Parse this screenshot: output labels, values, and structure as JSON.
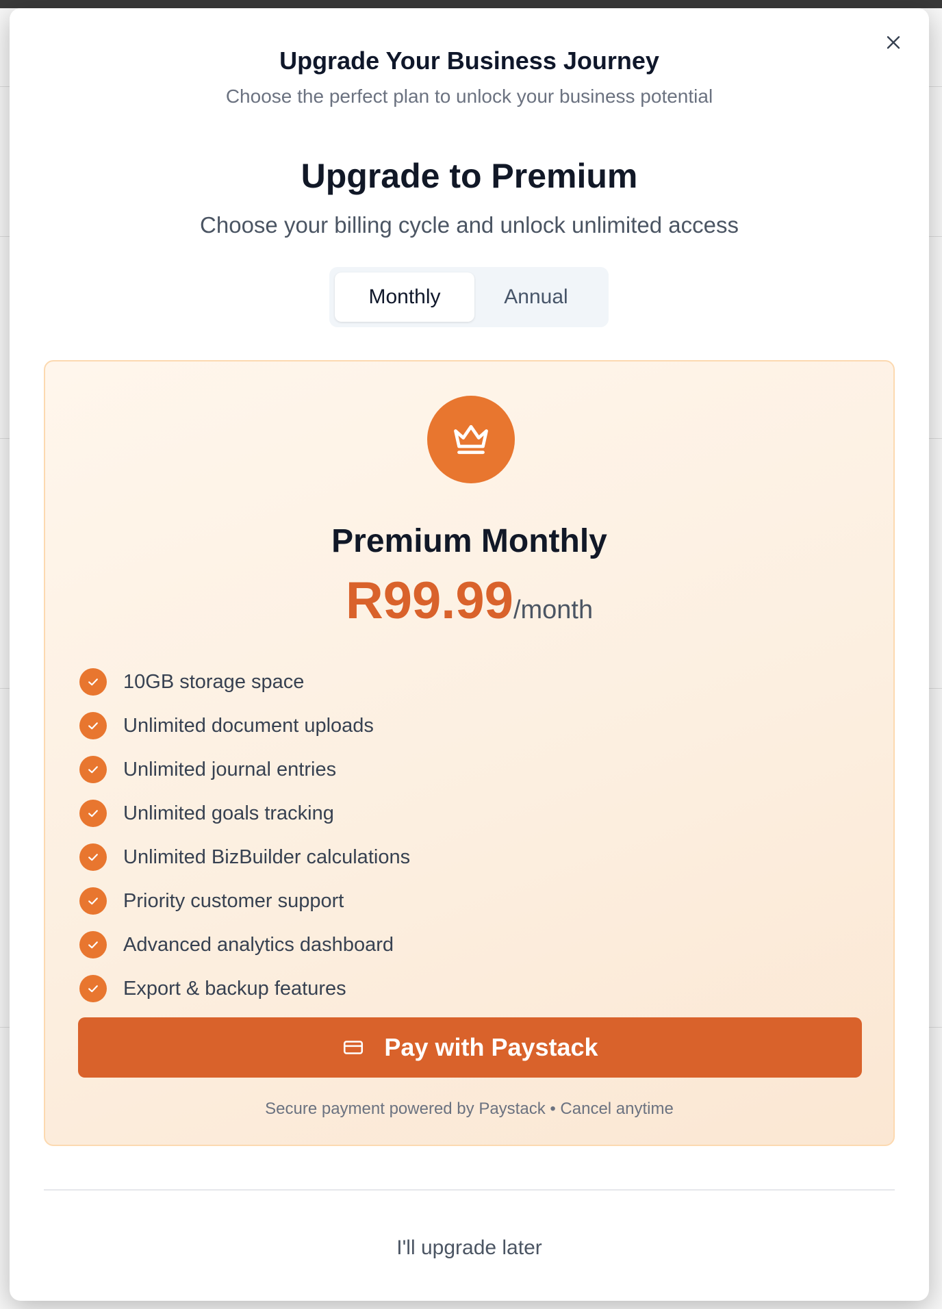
{
  "modal": {
    "title": "Upgrade Your Business Journey",
    "subtitle": "Choose the perfect plan to unlock your business potential",
    "close_icon": "close-icon"
  },
  "upgrade": {
    "title": "Upgrade to Premium",
    "subtitle": "Choose your billing cycle and unlock unlimited access"
  },
  "billing_toggle": {
    "options": [
      "Monthly",
      "Annual"
    ],
    "selected": "Monthly"
  },
  "plan": {
    "icon": "crown-icon",
    "name": "Premium Monthly",
    "price": "R99.99",
    "period": "/month",
    "features": [
      "10GB storage space",
      "Unlimited document uploads",
      "Unlimited journal entries",
      "Unlimited goals tracking",
      "Unlimited BizBuilder calculations",
      "Priority customer support",
      "Advanced analytics dashboard",
      "Export & backup features"
    ],
    "pay_button": "Pay with Paystack",
    "pay_icon": "credit-card-icon",
    "secure_note": "Secure payment powered by Paystack • Cancel anytime"
  },
  "footer": {
    "later_link": "I'll upgrade later"
  },
  "colors": {
    "accent": "#d9622b",
    "accent_light": "#e8762f",
    "card_bg": "#fff6ec",
    "card_border": "#fcd9b0"
  }
}
